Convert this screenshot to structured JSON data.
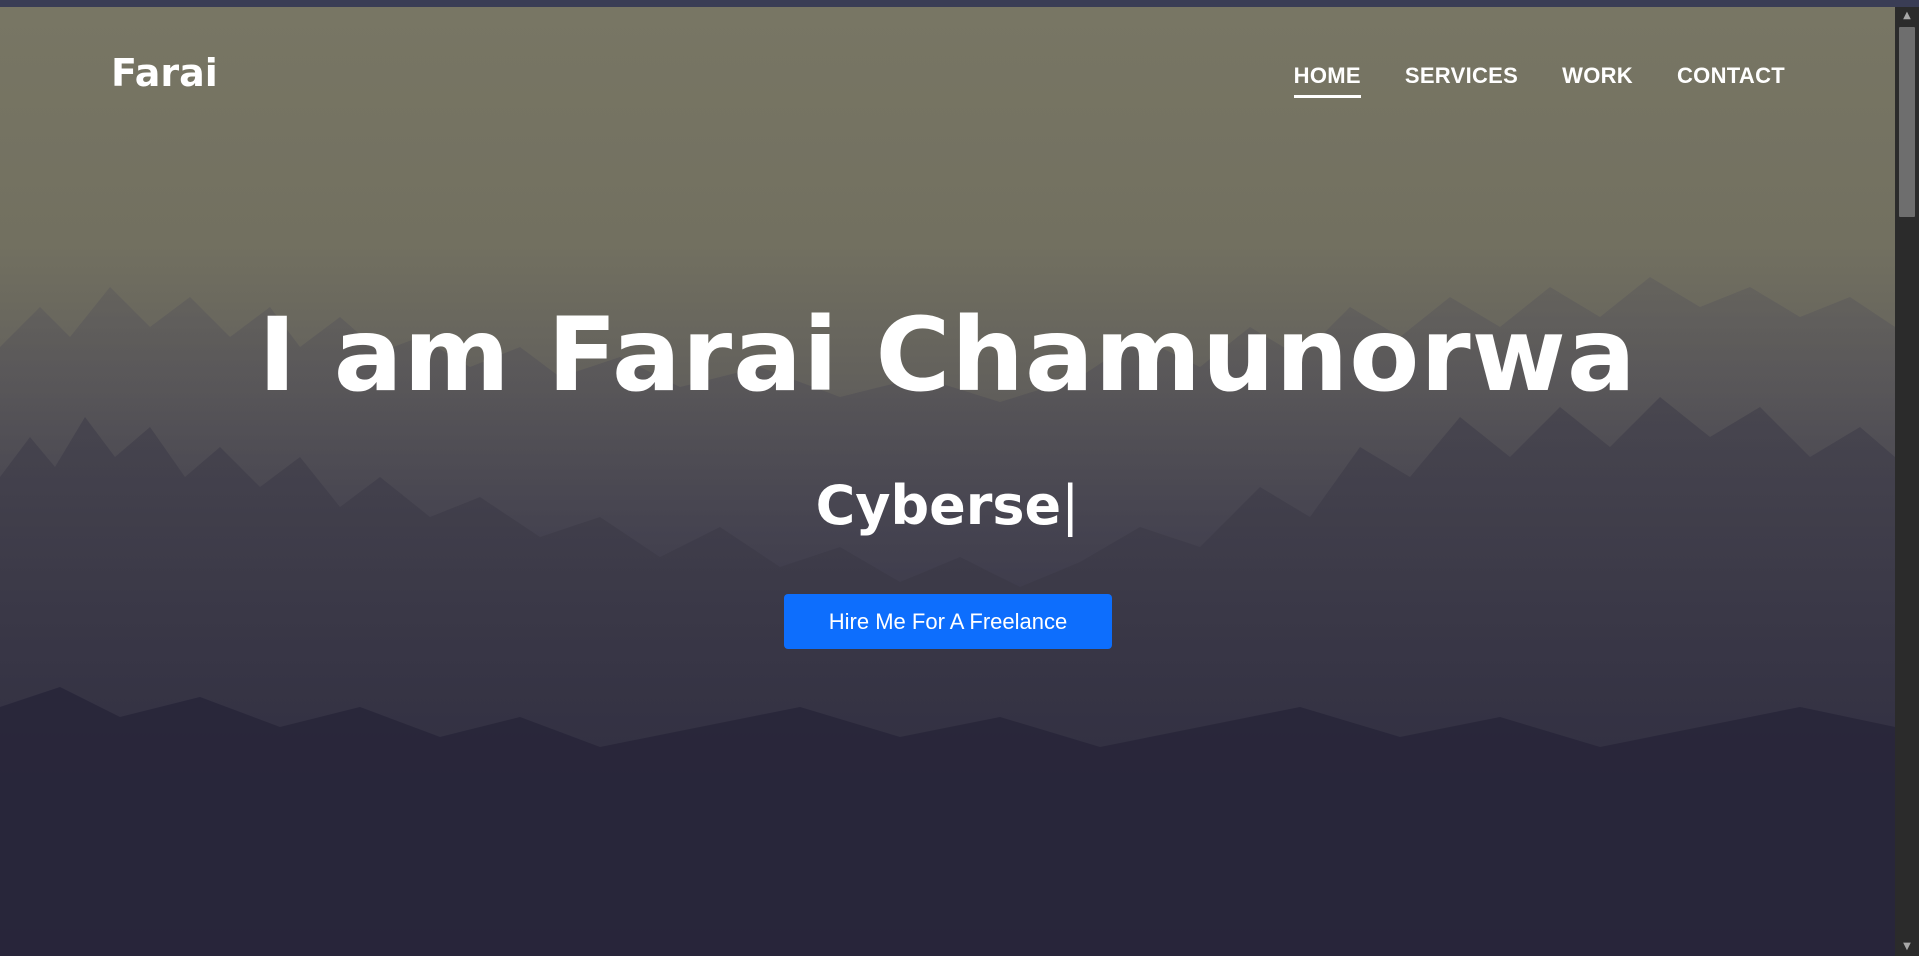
{
  "brand": "Farai",
  "nav": {
    "items": [
      {
        "label": "HOME",
        "active": true
      },
      {
        "label": "SERVICES",
        "active": false
      },
      {
        "label": "WORK",
        "active": false
      },
      {
        "label": "CONTACT",
        "active": false
      }
    ]
  },
  "hero": {
    "title": "I am Farai Chamunorwa",
    "typed_text": "Cyberse",
    "cursor": "|",
    "button_label": "Hire Me For A Freelance"
  },
  "colors": {
    "button": "#0d6efd",
    "text": "#ffffff",
    "scrollbar": "#2b2b2b",
    "scroll_thumb": "#6e6e6e"
  },
  "icons": {
    "scroll_up": "triangle-up-icon",
    "scroll_down": "triangle-down-icon"
  }
}
